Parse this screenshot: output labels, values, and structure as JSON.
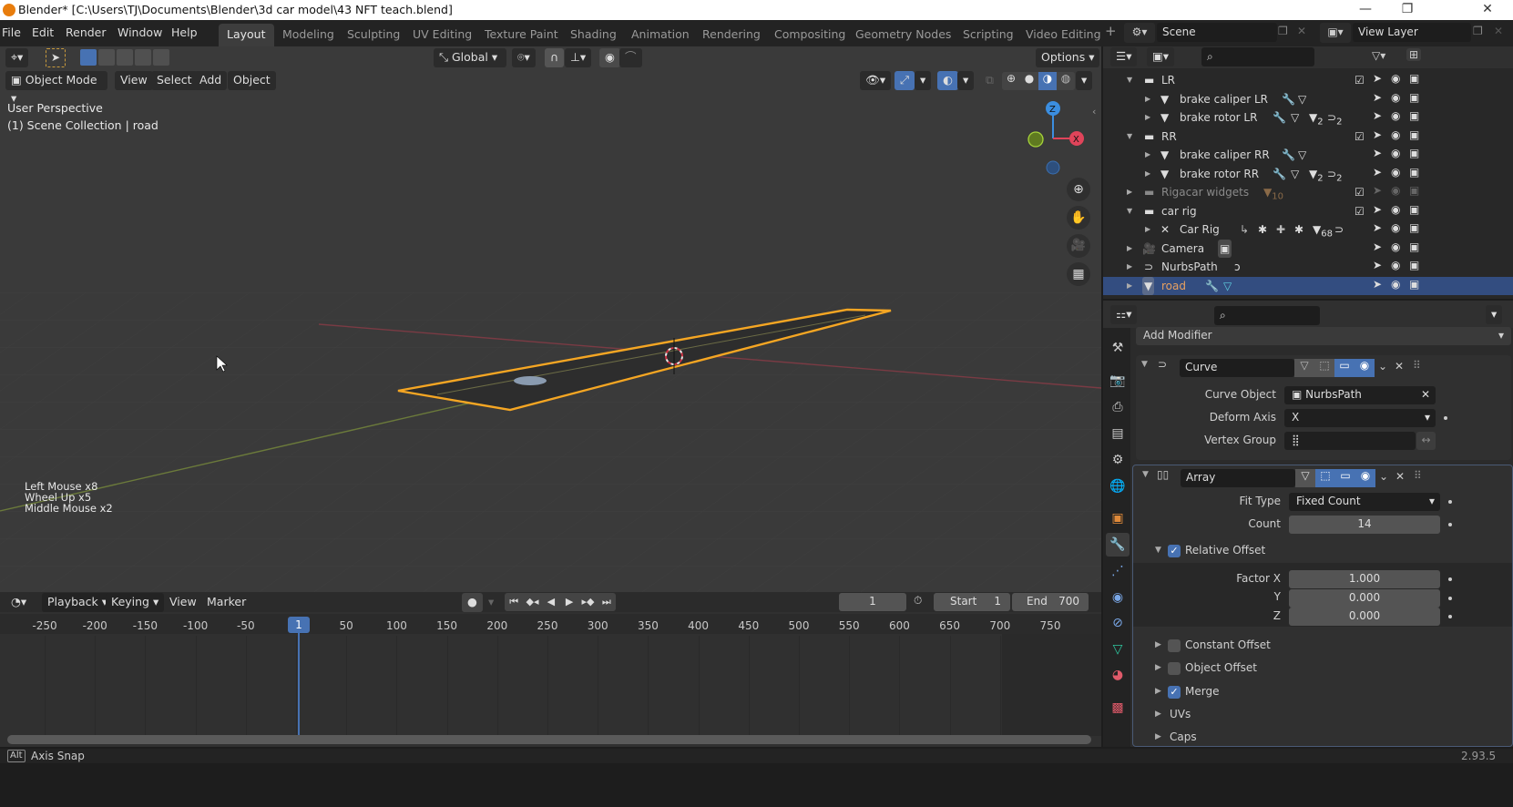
{
  "window": {
    "title": "Blender* [C:\\Users\\TJ\\Documents\\Blender\\3d car model\\43 NFT teach.blend]",
    "controls": {
      "minimize": "—",
      "maximize": "❐",
      "close": "✕"
    }
  },
  "menubar": {
    "items": [
      "File",
      "Edit",
      "Render",
      "Window",
      "Help"
    ]
  },
  "workspaces": {
    "tabs": [
      "Layout",
      "Modeling",
      "Sculpting",
      "UV Editing",
      "Texture Paint",
      "Shading",
      "Animation",
      "Rendering",
      "Compositing",
      "Geometry Nodes",
      "Scripting",
      "Video Editing"
    ],
    "active": "Layout",
    "add_label": "+"
  },
  "scene": {
    "name": "Scene",
    "view_layer": "View Layer"
  },
  "viewport": {
    "transform_orientation": "Global",
    "options_label": "Options",
    "mode": "Object Mode",
    "menus": [
      "View",
      "Select",
      "Add",
      "Object"
    ],
    "overlay_text": {
      "line1": "User Perspective",
      "line2": "(1) Scene Collection | road"
    },
    "input_log": [
      "Left Mouse x8",
      "Wheel Up x5",
      "Middle Mouse x2"
    ],
    "gizmo": {
      "z": "Z",
      "x": "X"
    },
    "colors": {
      "selection_outline": "#f5a623",
      "x_axis": "#e0445a",
      "z_axis": "#3b8ee0",
      "y_axis": "#8bbf2a"
    }
  },
  "outliner": {
    "rows": [
      {
        "name": "LR",
        "type": "collection",
        "expanded": true,
        "checked": true,
        "badges": []
      },
      {
        "name": "brake caliper LR",
        "type": "mesh",
        "badges": [
          "wrench-icon",
          "mesh-data-icon"
        ]
      },
      {
        "name": "brake rotor LR",
        "type": "mesh",
        "badges": [
          "wrench-icon",
          "mesh-data-icon",
          "mesh-2",
          "curve-2"
        ],
        "counts": [
          "2",
          "2"
        ]
      },
      {
        "name": "RR",
        "type": "collection",
        "expanded": true,
        "checked": true,
        "badges": []
      },
      {
        "name": "brake caliper RR",
        "type": "mesh",
        "badges": [
          "wrench-icon",
          "mesh-data-icon"
        ]
      },
      {
        "name": "brake rotor RR",
        "type": "mesh",
        "badges": [
          "wrench-icon",
          "mesh-data-icon",
          "mesh-2",
          "curve-2"
        ],
        "counts": [
          "2",
          "2"
        ]
      },
      {
        "name": "Rigacar widgets",
        "type": "collection",
        "expanded": false,
        "checked": true,
        "disabled": true,
        "counts": [
          "10"
        ]
      },
      {
        "name": "car rig",
        "type": "collection",
        "expanded": true,
        "checked": true
      },
      {
        "name": "Car Rig",
        "type": "armature",
        "counts": [
          "68"
        ]
      },
      {
        "name": "Camera",
        "type": "camera"
      },
      {
        "name": "NurbsPath",
        "type": "curve"
      },
      {
        "name": "road",
        "type": "mesh",
        "selected": true
      }
    ]
  },
  "properties": {
    "add_modifier_label": "Add Modifier",
    "modifiers": [
      {
        "name": "Curve",
        "fields": [
          {
            "label": "Curve Object",
            "value": "NurbsPath"
          },
          {
            "label": "Deform Axis",
            "value": "X"
          },
          {
            "label": "Vertex Group",
            "value": ""
          }
        ]
      },
      {
        "name": "Array",
        "fit_type_label": "Fit Type",
        "fit_type": "Fixed Count",
        "count_label": "Count",
        "count": "14",
        "relative_offset": {
          "label": "Relative Offset",
          "checked": true
        },
        "factor_x_label": "Factor X",
        "factor_x": "1.000",
        "y_label": "Y",
        "y": "0.000",
        "z_label": "Z",
        "z": "0.000",
        "subpanels": [
          {
            "label": "Constant Offset",
            "checked": false
          },
          {
            "label": "Object Offset",
            "checked": false
          },
          {
            "label": "Merge",
            "checked": true
          },
          {
            "label": "UVs"
          },
          {
            "label": "Caps"
          }
        ]
      }
    ]
  },
  "timeline": {
    "menus": [
      "Playback",
      "Keying",
      "View",
      "Marker"
    ],
    "current_frame": "1",
    "start_label": "Start",
    "start": "1",
    "end_label": "End",
    "end": "700",
    "ticks": [
      "-250",
      "-200",
      "-150",
      "-100",
      "-50",
      "1",
      "50",
      "100",
      "150",
      "200",
      "250",
      "300",
      "350",
      "400",
      "450",
      "500",
      "550",
      "600",
      "650",
      "700",
      "750"
    ]
  },
  "statusbar": {
    "key": "Alt",
    "hint": "Axis Snap",
    "version": "2.93.5"
  }
}
